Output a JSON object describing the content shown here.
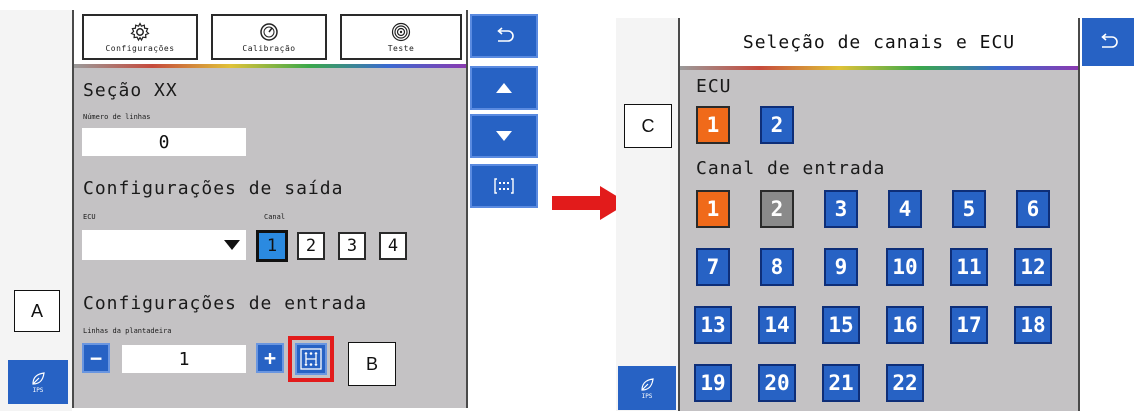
{
  "left_screen": {
    "tabs": [
      {
        "label": "Configurações",
        "icon": "gear-icon"
      },
      {
        "label": "Calibração",
        "icon": "gauge-icon"
      },
      {
        "label": "Teste",
        "icon": "target-icon"
      }
    ],
    "section_title": "Seção XX",
    "num_lines_label": "Número de linhas",
    "num_lines_value": "0",
    "output_title": "Configurações de saída",
    "ecu_label": "ECU",
    "canal_label": "Canal",
    "channels": [
      "1",
      "2",
      "3",
      "4"
    ],
    "selected_channel": "1",
    "input_title": "Configurações de entrada",
    "planter_lines_label": "Linhas da plantadeira",
    "planter_lines_value": "1",
    "minus_label": "−",
    "plus_label": "+",
    "nav_icons": [
      "undo-icon",
      "arrow-up-icon",
      "arrow-down-icon",
      "grid-icon"
    ],
    "ips_label": "IPS"
  },
  "callouts": {
    "a": "A",
    "b": "B",
    "c": "C"
  },
  "right_screen": {
    "title": "Seleção de canais e ECU",
    "ecu_label": "ECU",
    "ecu_options": [
      "1",
      "2"
    ],
    "selected_ecu": "1",
    "input_channel_label": "Canal de entrada",
    "channels": [
      "1",
      "2",
      "3",
      "4",
      "5",
      "6",
      "7",
      "8",
      "9",
      "10",
      "11",
      "12",
      "13",
      "14",
      "15",
      "16",
      "17",
      "18",
      "19",
      "20",
      "21",
      "22"
    ],
    "selected_channel": "1",
    "disabled_channel": "2",
    "ips_label": "IPS"
  },
  "colors": {
    "accent_blue": "#2762c4",
    "selected_orange": "#f06a1a",
    "disabled_gray": "#8a8a8a",
    "highlight_red": "#e21b1b",
    "panel_gray": "#c4c2c4"
  }
}
